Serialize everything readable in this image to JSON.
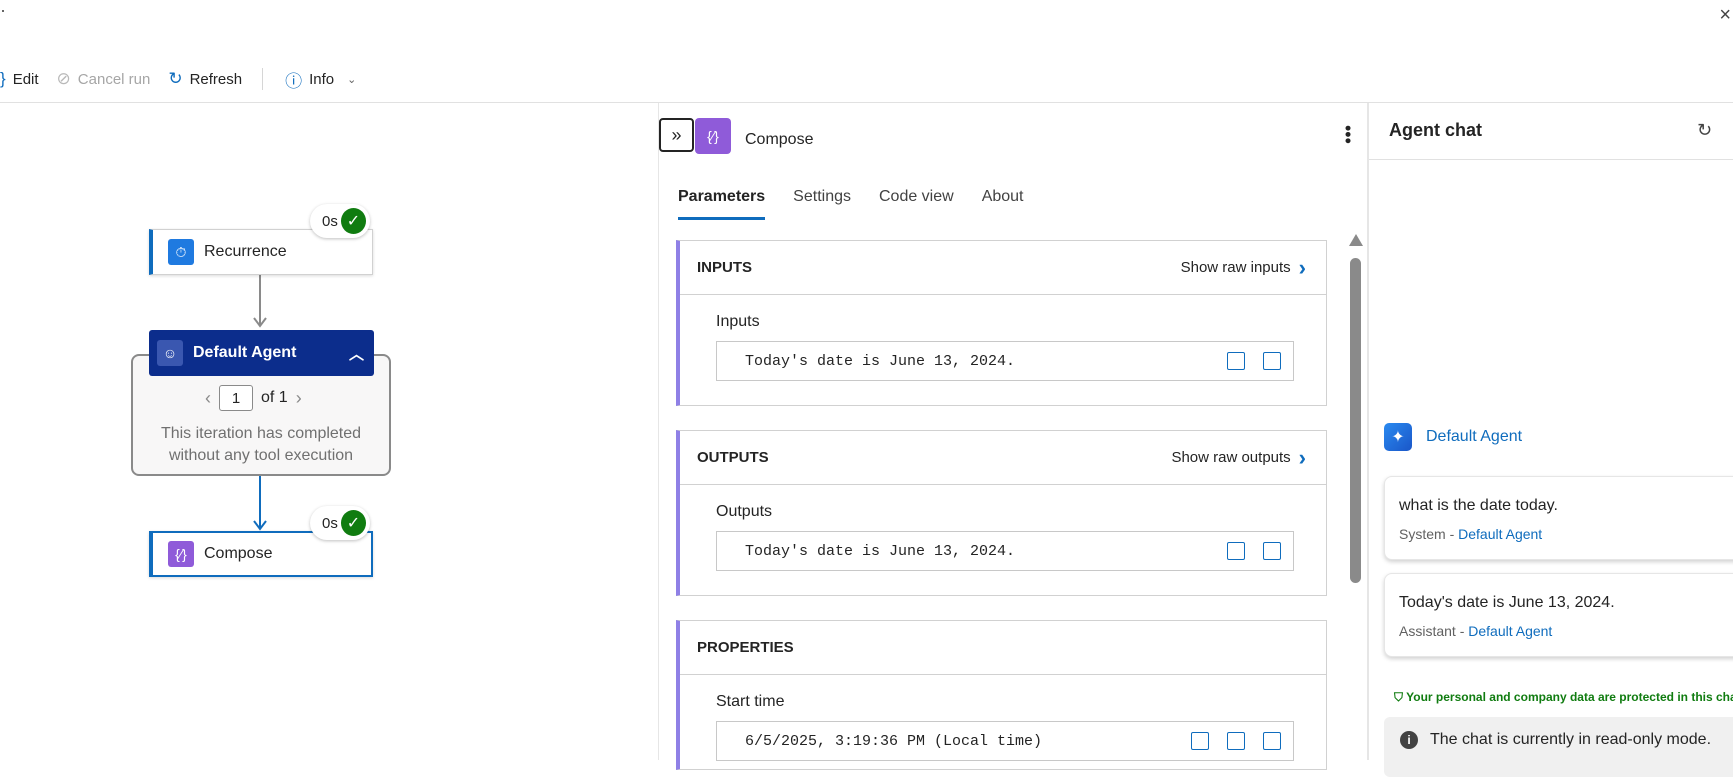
{
  "window": {
    "close_glyph": "×"
  },
  "toolbar": {
    "edit_label": "Edit",
    "cancel_label": "Cancel run",
    "refresh_label": "Refresh",
    "info_label": "Info"
  },
  "canvas": {
    "recurrence": {
      "label": "Recurrence",
      "duration": "0s"
    },
    "agent": {
      "label": "Default Agent",
      "page_current": "1",
      "page_total": "of 1",
      "iteration_text": "This iteration has completed without any tool execution"
    },
    "compose": {
      "label": "Compose",
      "duration": "0s"
    }
  },
  "panel": {
    "title": "Compose",
    "tabs": [
      {
        "label": "Parameters",
        "active": true
      },
      {
        "label": "Settings",
        "active": false
      },
      {
        "label": "Code view",
        "active": false
      },
      {
        "label": "About",
        "active": false
      }
    ],
    "inputs": {
      "header": "INPUTS",
      "raw_link": "Show raw inputs",
      "label": "Inputs",
      "value": "Today's date is June 13, 2024."
    },
    "outputs": {
      "header": "OUTPUTS",
      "raw_link": "Show raw outputs",
      "label": "Outputs",
      "value": "Today's date is June 13, 2024."
    },
    "properties": {
      "header": "PROPERTIES",
      "label": "Start time",
      "value": "6/5/2025, 3:19:36 PM (Local time)"
    }
  },
  "chat": {
    "title": "Agent chat",
    "agent_name": "Default Agent",
    "messages": [
      {
        "text": "what is the date today.",
        "role": "System - ",
        "agent": "Default Agent"
      },
      {
        "text": "Today's date is June 13, 2024.",
        "role": "Assistant - ",
        "agent": "Default Agent"
      }
    ],
    "protection_notice": "Your personal and company data are protected in this chat",
    "readonly_notice": "The chat is currently in read-only mode."
  }
}
